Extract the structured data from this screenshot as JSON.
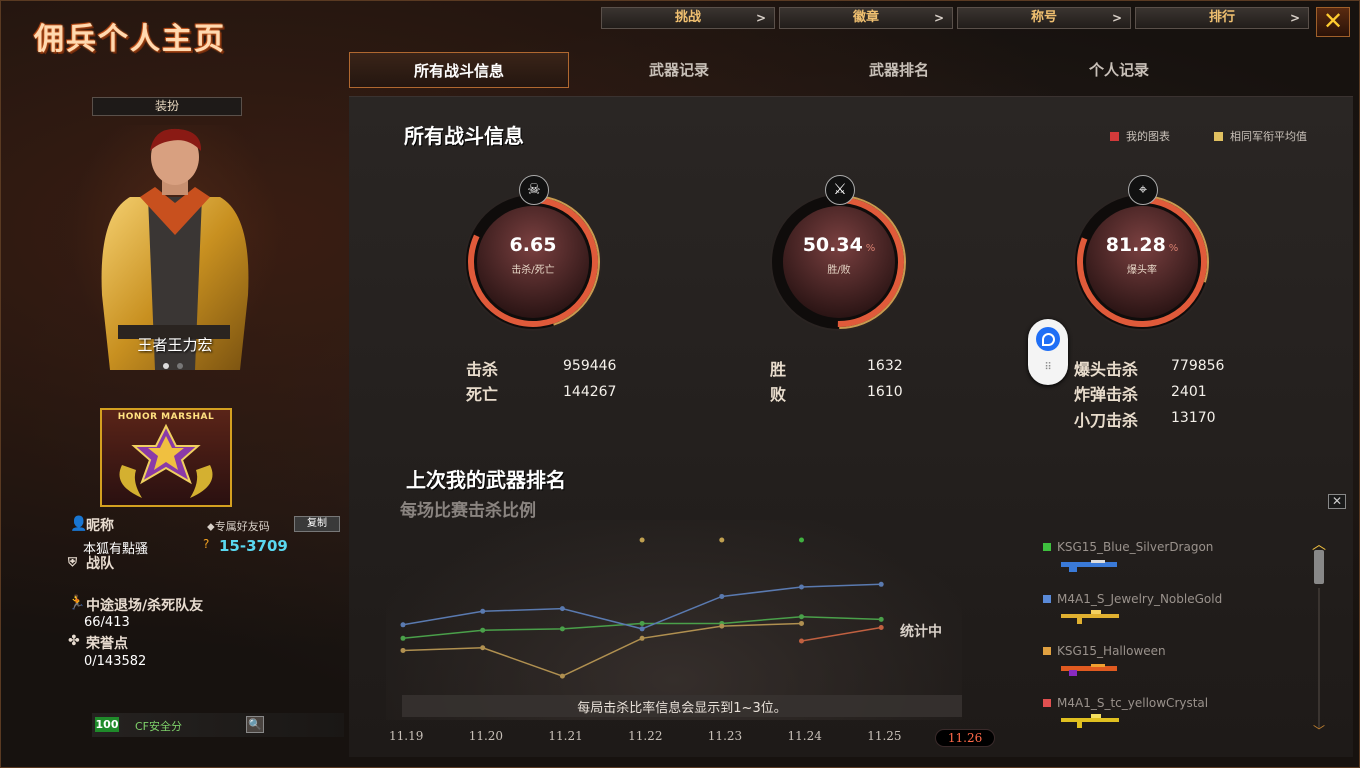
{
  "page_title": "佣兵个人主页",
  "top_menu": [
    {
      "label": "挑战",
      "chevron": ">"
    },
    {
      "label": "徽章",
      "chevron": ">"
    },
    {
      "label": "称号",
      "chevron": ">"
    },
    {
      "label": "排行",
      "chevron": ">"
    }
  ],
  "close_label": "✕",
  "tabs": [
    {
      "label": "所有战斗信息",
      "active": true
    },
    {
      "label": "武器记录"
    },
    {
      "label": "武器排名"
    },
    {
      "label": "个人记录"
    }
  ],
  "profile": {
    "dress_button": "装扮",
    "character_name": "王者王力宏",
    "rank_title": "HONOR MARSHAL",
    "nickname_label": "昵称",
    "nickname": "本狐有點骚",
    "friend_code_label": "专属好友码",
    "friend_code": "15-3709",
    "copy_button": "复制",
    "team_label": "战队",
    "quit_label": "中途退场/杀死队友",
    "quit_value": "66/413",
    "honor_label": "荣誉点",
    "honor_value": "0/143582",
    "security_score": "100",
    "security_label": "CF安全分"
  },
  "battle": {
    "title": "所有战斗信息",
    "legend": [
      {
        "label": "我的图表",
        "color": "#d23a3a"
      },
      {
        "label": "相同军衔平均值",
        "color": "#e0c060"
      }
    ],
    "gauges": [
      {
        "value": "6.65",
        "unit": "",
        "label": "击杀/死亡",
        "icon": "skull-icon",
        "glyph": "☠",
        "fill": 0.82,
        "avg": 0.45
      },
      {
        "value": "50.34",
        "unit": "%",
        "label": "胜/败",
        "icon": "crossed-swords-icon",
        "glyph": "⚔",
        "fill": 0.5034,
        "avg": 0.5
      },
      {
        "value": "81.28",
        "unit": "%",
        "label": "爆头率",
        "icon": "rifle-icon",
        "glyph": "⌖",
        "fill": 0.8128,
        "avg": 0.3
      }
    ],
    "stats": {
      "kills_label": "击杀",
      "kills": "959446",
      "deaths_label": "死亡",
      "deaths": "144267",
      "wins_label": "胜",
      "wins": "1632",
      "losses_label": "败",
      "losses": "1610",
      "headshot_label": "爆头击杀",
      "headshot": "779856",
      "bomb_label": "炸弹击杀",
      "bomb": "2401",
      "knife_label": "小刀击杀",
      "knife": "13170"
    }
  },
  "weapon_rank": {
    "title": "上次我的武器排名",
    "subtitle": "每场比赛击杀比例",
    "note": "每局击杀比率信息会显示到1~3位。",
    "pending": "统计中",
    "weapons": [
      {
        "name": "KSG15_Blue_SilverDragon",
        "color": "#3ec03e",
        "gun": "#3a7ad8"
      },
      {
        "name": "M4A1_S_Jewelry_NobleGold",
        "color": "#5a8ad8",
        "gun": "#e0b030"
      },
      {
        "name": "KSG15_Halloween",
        "color": "#e0a040",
        "gun": "#e05a20"
      },
      {
        "name": "M4A1_S_tc_yellowCrystal",
        "color": "#e05050",
        "gun": "#e0c020"
      }
    ]
  },
  "chart_data": {
    "type": "line",
    "categories": [
      "11.19",
      "11.20",
      "11.21",
      "11.22",
      "11.23",
      "11.24",
      "11.25",
      "11.26"
    ],
    "active_category": "11.26",
    "series": [
      {
        "name": "KSG15_Blue_SilverDragon",
        "color": "#4aa04a",
        "values": [
          0.42,
          0.48,
          0.49,
          0.53,
          0.53,
          0.58,
          0.56,
          null
        ]
      },
      {
        "name": "M4A1_S_Jewelry_NobleGold",
        "color": "#5a7ab0",
        "values": [
          0.52,
          0.62,
          0.64,
          0.49,
          0.73,
          0.8,
          0.82,
          null
        ]
      },
      {
        "name": "KSG15_Halloween",
        "color": "#b09050",
        "values": [
          0.33,
          0.35,
          0.14,
          0.42,
          0.51,
          0.53,
          null,
          null
        ]
      },
      {
        "name": "M4A1_S_tc_yellowCrystal",
        "color": "#c06040",
        "values": [
          null,
          null,
          null,
          null,
          null,
          0.4,
          0.5,
          null
        ]
      }
    ],
    "top_markers": [
      {
        "x": "11.22",
        "color": "#c0a050"
      },
      {
        "x": "11.23",
        "color": "#c0a050"
      },
      {
        "x": "11.24",
        "color": "#40b040"
      }
    ],
    "ylim": [
      0,
      1
    ],
    "grid": false,
    "legend": "right"
  }
}
